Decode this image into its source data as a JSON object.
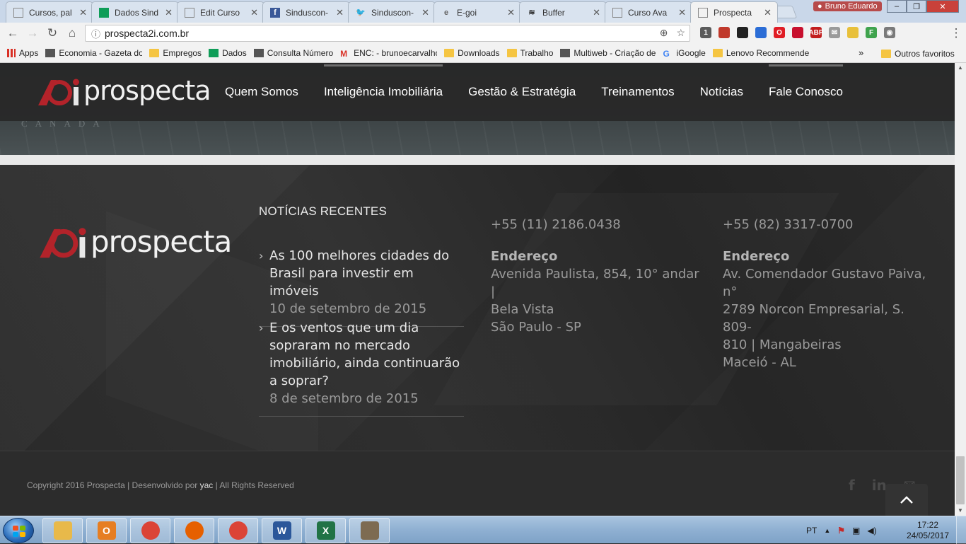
{
  "browser": {
    "tabs": [
      {
        "title": "Cursos, pal",
        "icon": "doc",
        "color": "#888888"
      },
      {
        "title": "Dados Sind",
        "icon": "sheet",
        "color": "#0f9d58"
      },
      {
        "title": "Edit Curso",
        "icon": "doc",
        "color": "#888888"
      },
      {
        "title": "Sinduscon-",
        "icon": "facebook",
        "color": "#3b5998"
      },
      {
        "title": "Sinduscon-",
        "icon": "twitter",
        "color": "#1da1f2"
      },
      {
        "title": "E-goi",
        "icon": "egoi",
        "color": "#666666"
      },
      {
        "title": "Buffer",
        "icon": "buffer",
        "color": "#222222"
      },
      {
        "title": "Curso Ava",
        "icon": "doc",
        "color": "#888888"
      },
      {
        "title": "Prospecta",
        "icon": "doc",
        "color": "#888888"
      }
    ],
    "close_glyph": "✕",
    "profile_name": "Bruno Eduardo",
    "window_controls": {
      "minimize": "‒",
      "maximize": "❐",
      "close": "✕"
    },
    "nav": {
      "back": "←",
      "forward": "→",
      "reload": "↻",
      "home": "⌂"
    },
    "address": {
      "info_icon": "ⓘ",
      "url": "prospecta2i.com.br",
      "zoom_icon": "⊕",
      "star_icon": "☆"
    },
    "menu_icon": "⋮",
    "extensions": [
      {
        "label": "1",
        "color": "#5b5b5b"
      },
      {
        "label": "",
        "color": "#c0392b"
      },
      {
        "label": "",
        "color": "#222222"
      },
      {
        "label": "",
        "color": "#2b6dd6"
      },
      {
        "label": "O",
        "color": "#e01d25"
      },
      {
        "label": "",
        "color": "#c8102e"
      },
      {
        "label": "ABP",
        "color": "#c21d1d"
      },
      {
        "label": "✉",
        "color": "#9a9a9a"
      },
      {
        "label": "",
        "color": "#e8c03a"
      },
      {
        "label": "F",
        "color": "#3fa34d"
      },
      {
        "label": "◉",
        "color": "#7a7a7a"
      }
    ],
    "bookmarks": [
      {
        "label": "Apps",
        "type": "apps"
      },
      {
        "label": "Economia - Gazeta do",
        "type": "site"
      },
      {
        "label": "Empregos",
        "type": "folder"
      },
      {
        "label": "Dados",
        "type": "sheet"
      },
      {
        "label": "Consulta Número",
        "type": "site"
      },
      {
        "label": "ENC: - brunoecarvalho",
        "type": "gmail"
      },
      {
        "label": "Downloads",
        "type": "folder"
      },
      {
        "label": "Trabalho",
        "type": "folder"
      },
      {
        "label": "Multiweb - Criação de",
        "type": "site"
      },
      {
        "label": "iGoogle",
        "type": "google"
      },
      {
        "label": "Lenovo Recommende",
        "type": "folder"
      }
    ],
    "bookmarks_more": "»",
    "other_bookmarks": "Outros favoritos"
  },
  "site": {
    "brand": "prospecta",
    "hero_map_label": "CANADA",
    "menu": [
      {
        "label": "Quem Somos",
        "active": false
      },
      {
        "label": "Inteligência Imobiliária",
        "active": true
      },
      {
        "label": "Gestão & Estratégia",
        "active": false
      },
      {
        "label": "Treinamentos",
        "active": false
      },
      {
        "label": "Notícias",
        "active": false
      },
      {
        "label": "Fale Conosco",
        "active": true
      }
    ],
    "footer": {
      "news_title": "NOTÍCIAS RECENTES",
      "news": [
        {
          "title_lines": [
            "As 100 melhores cidades do",
            "Brasil para investir em imóveis"
          ],
          "date": "10 de setembro de 2015"
        },
        {
          "title_lines": [
            "E os ventos que um dia",
            "sopraram no mercado",
            "imobiliário, ainda continuarão",
            "a soprar?"
          ],
          "date": "8 de setembro de 2015"
        }
      ],
      "contacts": [
        {
          "phone": "+55 (11) 2186.0438",
          "label": "Endereço",
          "lines": [
            "Avenida Paulista, 854, 10° andar |",
            "Bela Vista",
            "São Paulo - SP"
          ]
        },
        {
          "phone": "+55 (82) 3317-0700",
          "label": "Endereço",
          "lines": [
            "Av. Comendador Gustavo Paiva, n°",
            "2789 Norcon Empresarial, S. 809-",
            "810 | Mangabeiras",
            "Maceió - AL"
          ]
        }
      ],
      "chevron_glyph": "›"
    },
    "bottom": {
      "copyright_prefix": "Copyright 2016 Prospecta | Desenvolvido por ",
      "developer": "yac",
      "copyright_suffix": " | All Rights Reserved",
      "social": {
        "facebook": "f",
        "linkedin": "in",
        "email": "✉"
      }
    }
  },
  "taskbar": {
    "apps": [
      {
        "name": "explorer",
        "color": "#e8b94a",
        "label": ""
      },
      {
        "name": "outlook",
        "color": "#e67e22",
        "label": "O"
      },
      {
        "name": "chrome",
        "color": "#db4437",
        "label": ""
      },
      {
        "name": "firefox",
        "color": "#e66000",
        "label": ""
      },
      {
        "name": "chrome",
        "color": "#db4437",
        "label": ""
      },
      {
        "name": "word",
        "color": "#2b579a",
        "label": "W"
      },
      {
        "name": "excel",
        "color": "#217346",
        "label": "X"
      },
      {
        "name": "gimp",
        "color": "#7d6b52",
        "label": ""
      }
    ],
    "lang": "PT",
    "tray_up": "▲",
    "time": "17:22",
    "date": "24/05/2017"
  }
}
